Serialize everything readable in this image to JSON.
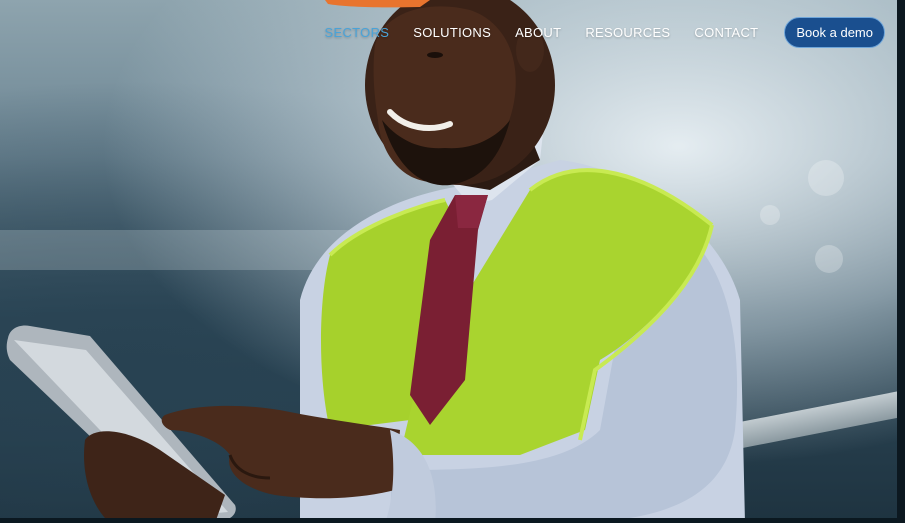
{
  "nav": {
    "items": [
      {
        "label": "SECTORS",
        "active": true
      },
      {
        "label": "SOLUTIONS",
        "active": false
      },
      {
        "label": "ABOUT",
        "active": false
      },
      {
        "label": "RESOURCES",
        "active": false
      },
      {
        "label": "CONTACT",
        "active": false
      }
    ],
    "cta_label": "Book a demo"
  },
  "colors": {
    "nav_active": "#4aa3d8",
    "cta_background": "#1a4f8f",
    "vest": "#a6d12c",
    "hardhat": "#e8742e",
    "tie": "#7a1f33",
    "shirt": "#c8d2e3"
  },
  "hero": {
    "image_subject": "construction-worker-with-tablet"
  }
}
